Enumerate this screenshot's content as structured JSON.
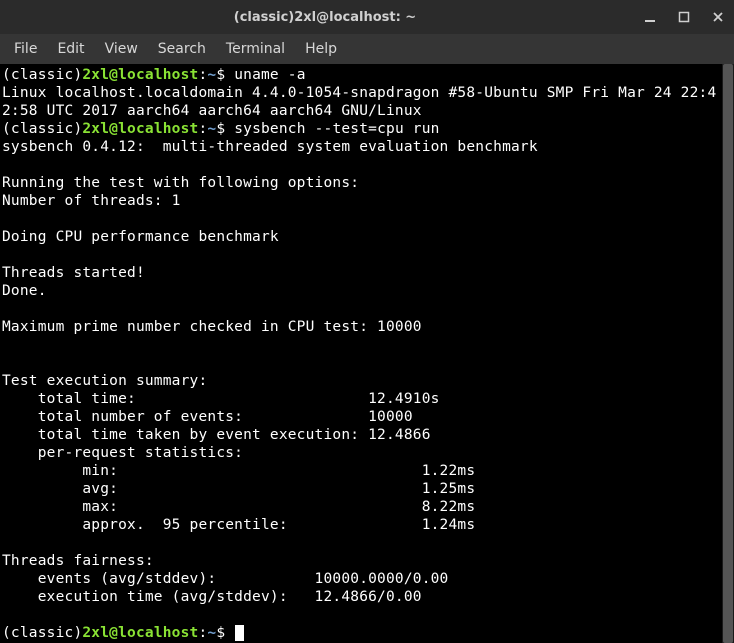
{
  "window": {
    "title": "(classic)2xl@localhost: ~"
  },
  "menubar": {
    "items": [
      "File",
      "Edit",
      "View",
      "Search",
      "Terminal",
      "Help"
    ]
  },
  "prompt": {
    "classic": "(classic)",
    "user_host": "2xl@localhost",
    "colon": ":",
    "path": "~",
    "dollar": "$"
  },
  "commands": {
    "cmd1": " uname -a",
    "cmd2": " sysbench --test=cpu run",
    "cmd3": " "
  },
  "output": {
    "uname": "Linux localhost.localdomain 4.4.0-1054-snapdragon #58-Ubuntu SMP Fri Mar 24 22:4\n2:58 UTC 2017 aarch64 aarch64 aarch64 GNU/Linux",
    "sysbench_header": "sysbench 0.4.12:  multi-threaded system evaluation benchmark",
    "running": "Running the test with following options:",
    "threads_num": "Number of threads: 1",
    "doing": "Doing CPU performance benchmark",
    "started": "Threads started!",
    "done": "Done.",
    "maxprime": "Maximum prime number checked in CPU test: 10000",
    "summary_hdr": "Test execution summary:",
    "total_time": "    total time:                          12.4910s",
    "total_events": "    total number of events:              10000",
    "total_exec": "    total time taken by event execution: 12.4866",
    "per_req_hdr": "    per-request statistics:",
    "min": "         min:                                  1.22ms",
    "avg": "         avg:                                  1.25ms",
    "max": "         max:                                  8.22ms",
    "p95": "         approx.  95 percentile:               1.24ms",
    "fairness_hdr": "Threads fairness:",
    "events_fair": "    events (avg/stddev):           10000.0000/0.00",
    "exec_fair": "    execution time (avg/stddev):   12.4866/0.00"
  }
}
